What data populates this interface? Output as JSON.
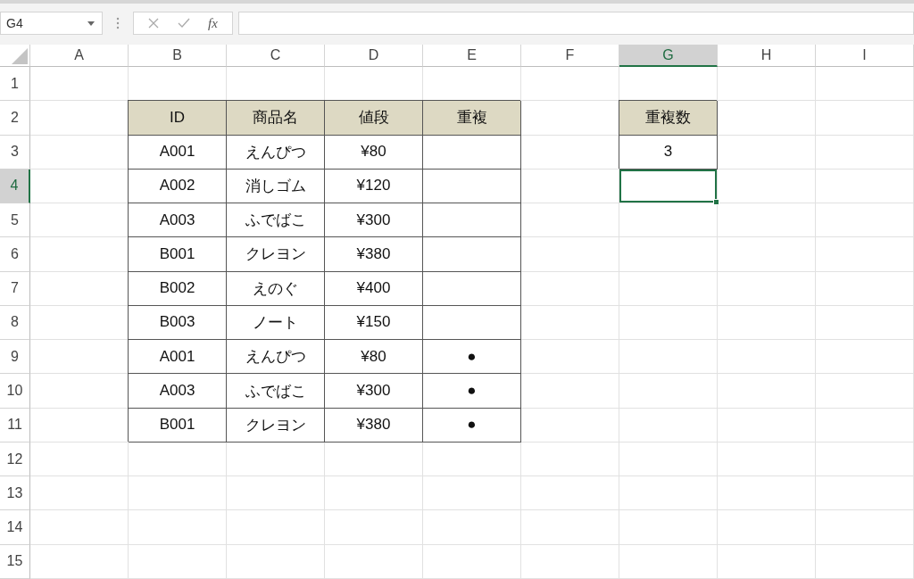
{
  "name_box": {
    "value": "G4"
  },
  "formula_bar": {
    "function_label": "fx"
  },
  "columns": [
    {
      "label": "A",
      "selected": false
    },
    {
      "label": "B",
      "selected": false
    },
    {
      "label": "C",
      "selected": false
    },
    {
      "label": "D",
      "selected": false
    },
    {
      "label": "E",
      "selected": false
    },
    {
      "label": "F",
      "selected": false
    },
    {
      "label": "G",
      "selected": true
    },
    {
      "label": "H",
      "selected": false
    },
    {
      "label": "I",
      "selected": false
    }
  ],
  "rows": [
    {
      "number": "1",
      "selected": false,
      "cells": {}
    },
    {
      "number": "2",
      "selected": false,
      "cells": {
        "B": {
          "text": "ID",
          "kind": "header"
        },
        "C": {
          "text": "商品名",
          "kind": "header"
        },
        "D": {
          "text": "値段",
          "kind": "header"
        },
        "E": {
          "text": "重複",
          "kind": "header"
        },
        "G": {
          "text": "重複数",
          "kind": "header"
        }
      }
    },
    {
      "number": "3",
      "selected": false,
      "cells": {
        "B": {
          "text": "A001",
          "kind": "body"
        },
        "C": {
          "text": "えんぴつ",
          "kind": "body"
        },
        "D": {
          "text": "¥80",
          "kind": "body"
        },
        "E": {
          "kind": "body"
        },
        "G": {
          "text": "3",
          "kind": "body"
        }
      }
    },
    {
      "number": "4",
      "selected": true,
      "cells": {
        "B": {
          "text": "A002",
          "kind": "body"
        },
        "C": {
          "text": "消しゴム",
          "kind": "body"
        },
        "D": {
          "text": "¥120",
          "kind": "body"
        },
        "E": {
          "kind": "body"
        },
        "G": {
          "kind": "plain",
          "active": true
        }
      }
    },
    {
      "number": "5",
      "selected": false,
      "cells": {
        "B": {
          "text": "A003",
          "kind": "body"
        },
        "C": {
          "text": "ふでばこ",
          "kind": "body"
        },
        "D": {
          "text": "¥300",
          "kind": "body"
        },
        "E": {
          "kind": "body"
        }
      }
    },
    {
      "number": "6",
      "selected": false,
      "cells": {
        "B": {
          "text": "B001",
          "kind": "body"
        },
        "C": {
          "text": "クレヨン",
          "kind": "body"
        },
        "D": {
          "text": "¥380",
          "kind": "body"
        },
        "E": {
          "kind": "body"
        }
      }
    },
    {
      "number": "7",
      "selected": false,
      "cells": {
        "B": {
          "text": "B002",
          "kind": "body"
        },
        "C": {
          "text": "えのぐ",
          "kind": "body"
        },
        "D": {
          "text": "¥400",
          "kind": "body"
        },
        "E": {
          "kind": "body"
        }
      }
    },
    {
      "number": "8",
      "selected": false,
      "cells": {
        "B": {
          "text": "B003",
          "kind": "body"
        },
        "C": {
          "text": "ノート",
          "kind": "body"
        },
        "D": {
          "text": "¥150",
          "kind": "body"
        },
        "E": {
          "kind": "body"
        }
      }
    },
    {
      "number": "9",
      "selected": false,
      "cells": {
        "B": {
          "text": "A001",
          "kind": "body"
        },
        "C": {
          "text": "えんぴつ",
          "kind": "body"
        },
        "D": {
          "text": "¥80",
          "kind": "body"
        },
        "E": {
          "text": "●",
          "kind": "body"
        }
      }
    },
    {
      "number": "10",
      "selected": false,
      "cells": {
        "B": {
          "text": "A003",
          "kind": "body"
        },
        "C": {
          "text": "ふでばこ",
          "kind": "body"
        },
        "D": {
          "text": "¥300",
          "kind": "body"
        },
        "E": {
          "text": "●",
          "kind": "body"
        }
      }
    },
    {
      "number": "11",
      "selected": false,
      "cells": {
        "B": {
          "text": "B001",
          "kind": "body"
        },
        "C": {
          "text": "クレヨン",
          "kind": "body"
        },
        "D": {
          "text": "¥380",
          "kind": "body"
        },
        "E": {
          "text": "●",
          "kind": "body"
        }
      }
    },
    {
      "number": "12",
      "selected": false,
      "cells": {}
    },
    {
      "number": "13",
      "selected": false,
      "cells": {}
    },
    {
      "number": "14",
      "selected": false,
      "cells": {}
    },
    {
      "number": "15",
      "selected": false,
      "cells": {}
    }
  ]
}
